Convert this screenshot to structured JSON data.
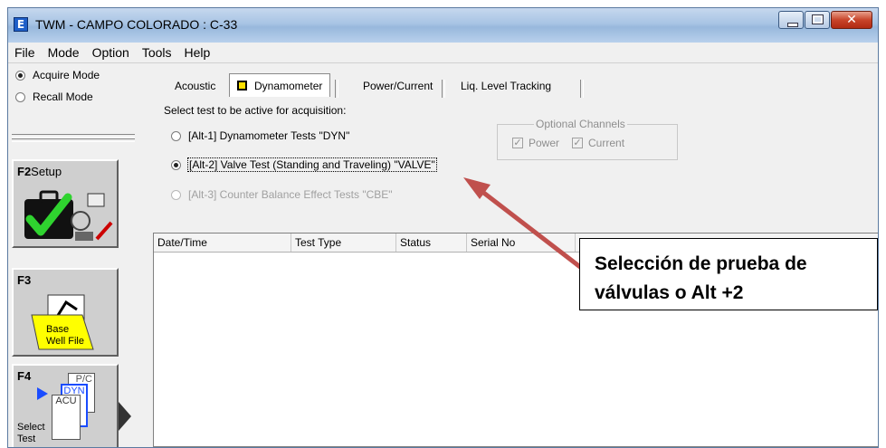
{
  "window": {
    "title": "TWM  -  CAMPO COLORADO : C-33",
    "app_icon_glyph": "E"
  },
  "menu": [
    "File",
    "Mode",
    "Option",
    "Tools",
    "Help"
  ],
  "left_panel": {
    "modes": [
      {
        "label": "Acquire Mode",
        "selected": true
      },
      {
        "label": "Recall Mode",
        "selected": false
      }
    ],
    "f2": {
      "key": "F2",
      "label": "Setup",
      "icon": "toolkit-checkmark-icon"
    },
    "f3": {
      "key": "F3",
      "label_line1": "Base",
      "label_line2": "Well File",
      "icon": "well-file-folder-icon"
    },
    "f4": {
      "key": "F4",
      "label_line1": "Select",
      "label_line2": "Test",
      "stack": [
        "P/C",
        "DYN",
        "ACU"
      ],
      "icon": "test-stack-icon"
    }
  },
  "tabs": [
    "Acoustic",
    "Dynamometer",
    "Power/Current",
    "Liq. Level Tracking"
  ],
  "active_tab": "Dynamometer",
  "test_select": {
    "prompt": "Select test to be active for acquisition:",
    "options": [
      {
        "label": "[Alt-1] Dynamometer Tests  \"DYN\"",
        "selected": false,
        "enabled": true
      },
      {
        "label": "[Alt-2] Valve Test (Standing and Traveling)  \"VALVE\"",
        "selected": true,
        "enabled": true
      },
      {
        "label": "[Alt-3] Counter Balance Effect Tests  \"CBE\"",
        "selected": false,
        "enabled": false
      }
    ]
  },
  "optional_channels": {
    "title": "Optional Channels",
    "items": [
      {
        "label": "Power",
        "checked": true
      },
      {
        "label": "Current",
        "checked": true
      }
    ]
  },
  "grid": {
    "columns": [
      "Date/Time",
      "Test Type",
      "Status",
      "Serial No",
      ""
    ]
  },
  "callout": {
    "line1": "Selección de prueba de",
    "line2": "válvulas o Alt +2"
  },
  "colors": {
    "arrow": "#c0504d",
    "f3_folder": "#ffff00",
    "dyn_indicator": "#ffe000"
  }
}
